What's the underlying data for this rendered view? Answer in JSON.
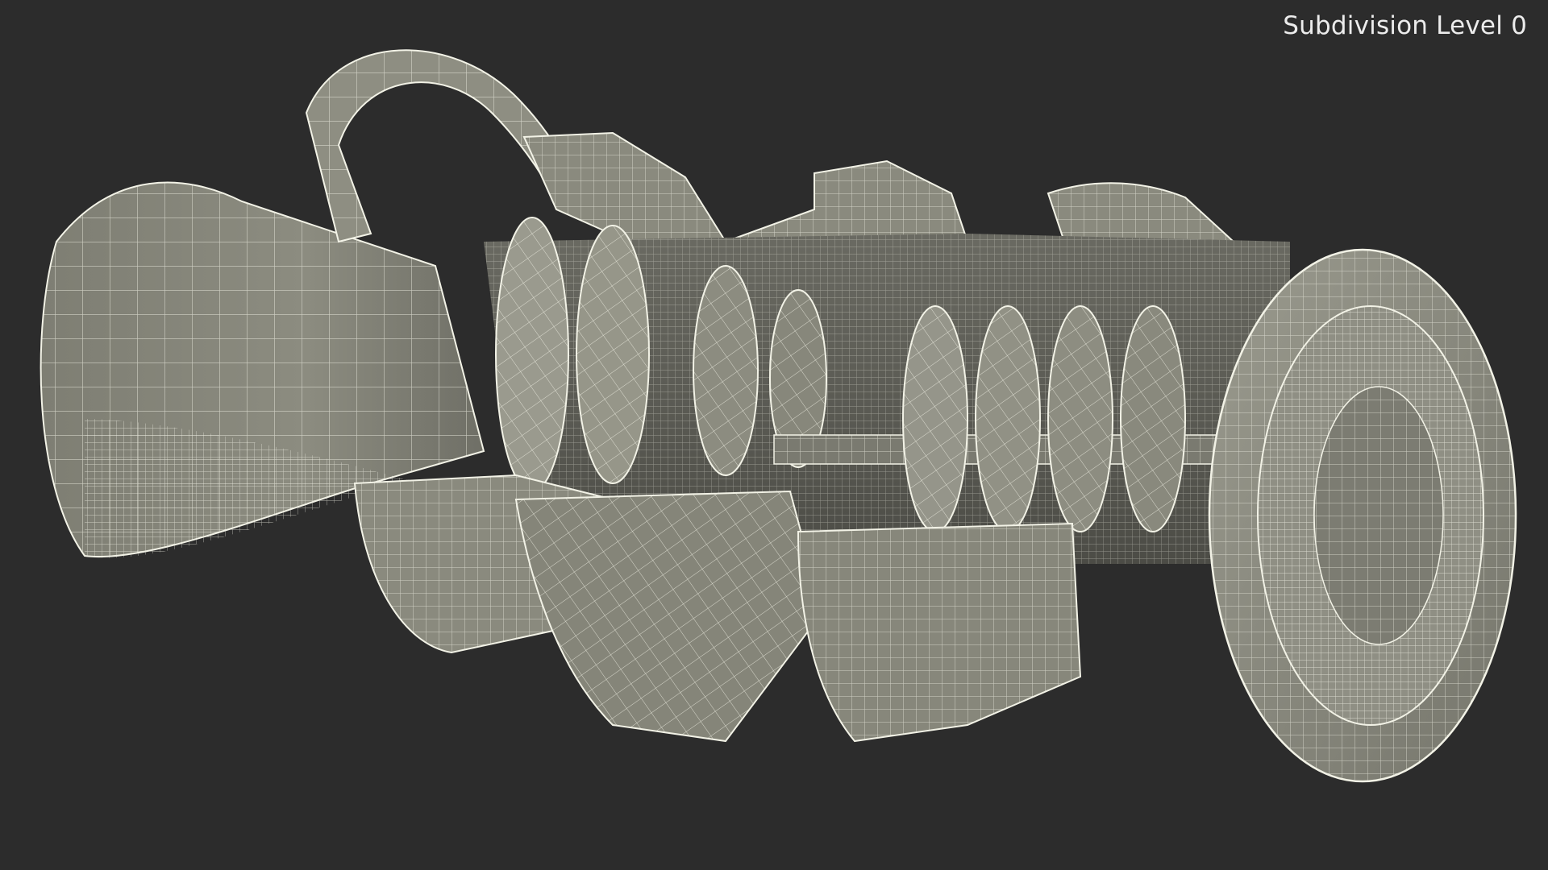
{
  "viewport": {
    "overlay_label": "Subdivision Level 0",
    "background_color": "#2c2c2c",
    "label_color": "#ececec"
  },
  "model": {
    "surface_color": "#8a8a7e",
    "surface_shadow_color": "#55554d",
    "cut_face_color": "#a3a396",
    "wire_color": "#f2f2e6"
  }
}
